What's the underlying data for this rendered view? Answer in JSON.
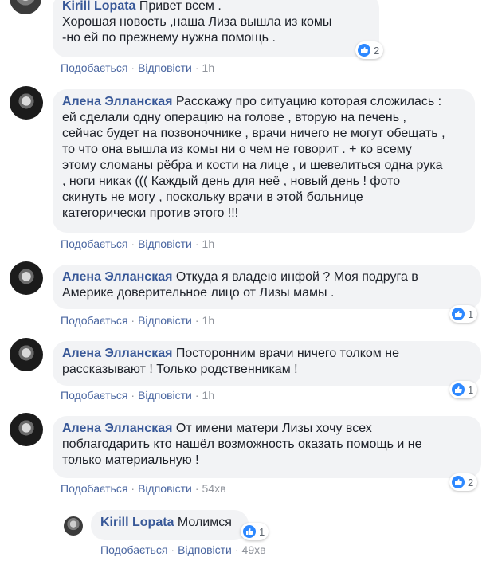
{
  "actions": {
    "like": "Подобається",
    "reply": "Відповісти"
  },
  "comments": [
    {
      "author": "Kirill Lopata",
      "text": "Привет всем .\nХорошая новость ,наша Лиза вышла из комы\n-но ей по прежнему нужна помощь .",
      "time": "1h",
      "reactions": "2",
      "avatar": "user-avatar"
    },
    {
      "author": "Алена Элланская",
      "text": "Расскажу про ситуацию которая сложилась :\nей сделали одну операцию на голове , вторую на печень ,\nсейчас будет на позвоночнике , врачи ничего не могут обещать ,\nто что она вышла из комы ни о чем не говорит . + ко всему\nэтому сломаны рёбра и кости на лице , и шевелиться одна рука\n, ноги никак ((( Каждый день для неё , новый день ! фото\nскинуть не могу , поскольку врачи в этой больнице\nкатегорически против этого !!!",
      "time": "1h",
      "reactions": "",
      "avatar": "user-avatar"
    },
    {
      "author": "Алена Элланская",
      "text": "Откуда я владею инфой ? Моя подруга в\nАмерике доверительное лицо от Лизы мамы .",
      "time": "1h",
      "reactions": "1",
      "avatar": "user-avatar"
    },
    {
      "author": "Алена Элланская",
      "text": "Посторонним врачи ничего толком не\nрассказывают ! Только родственникам !",
      "time": "1h",
      "reactions": "1",
      "avatar": "user-avatar"
    },
    {
      "author": "Алена Элланская",
      "text": "От имени матери Лизы хочу всех\nпоблагодарить кто нашёл возможность оказать помощь и не\nтолько материальную !",
      "time": "54хв",
      "reactions": "2",
      "avatar": "user-avatar"
    },
    {
      "author": "Kirill Lopata",
      "text": "Молимся",
      "time": "49хв",
      "reactions": "1",
      "avatar": "user-avatar"
    }
  ]
}
